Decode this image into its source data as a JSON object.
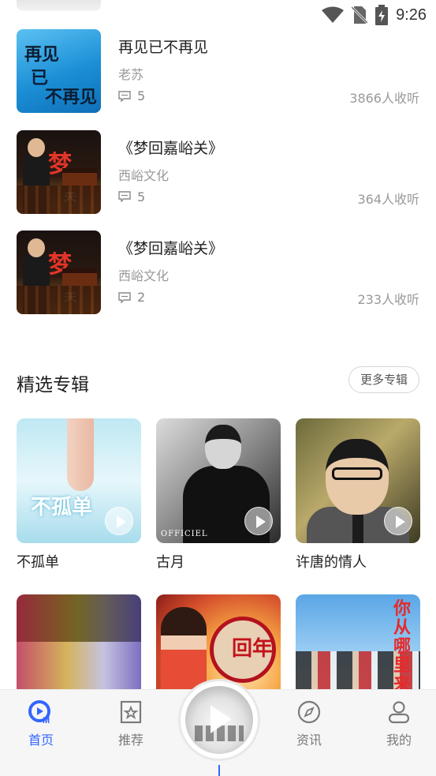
{
  "status_bar": {
    "time": "9:26"
  },
  "track_list": [
    {
      "title": "再见已不再见",
      "author": "老苏",
      "comments": "5",
      "listens": "3866人收听",
      "cover": "blue-calligraphy-cover"
    },
    {
      "title": "《梦回嘉峪关》",
      "author": "西峪文化",
      "comments": "5",
      "listens": "364人收听",
      "cover": "jiayuguan-cover"
    },
    {
      "title": "《梦回嘉峪关》",
      "author": "西峪文化",
      "comments": "2",
      "listens": "233人收听",
      "cover": "jiayuguan-cover"
    }
  ],
  "featured": {
    "title": "精选专辑",
    "more_label": "更多专辑",
    "albums": [
      {
        "name": "不孤单",
        "cover_text": "不孤单"
      },
      {
        "name": "古月",
        "cover_text": "OFFICIEL"
      },
      {
        "name": "许唐的情人"
      },
      {
        "name": ""
      },
      {
        "name": "",
        "cover_text": "回年"
      },
      {
        "name": "",
        "cover_text": "你从哪里来"
      }
    ]
  },
  "tab_bar": {
    "items": [
      {
        "label": "首页",
        "icon": "home-logo-icon",
        "active": true
      },
      {
        "label": "推荐",
        "icon": "star-bookmark-icon",
        "active": false
      },
      {
        "label": "资讯",
        "icon": "compass-icon",
        "active": false
      },
      {
        "label": "我的",
        "icon": "user-icon",
        "active": false
      }
    ]
  },
  "colors": {
    "accent": "#3366ff",
    "muted": "#999999",
    "tab_inactive": "#7b7b7b"
  }
}
